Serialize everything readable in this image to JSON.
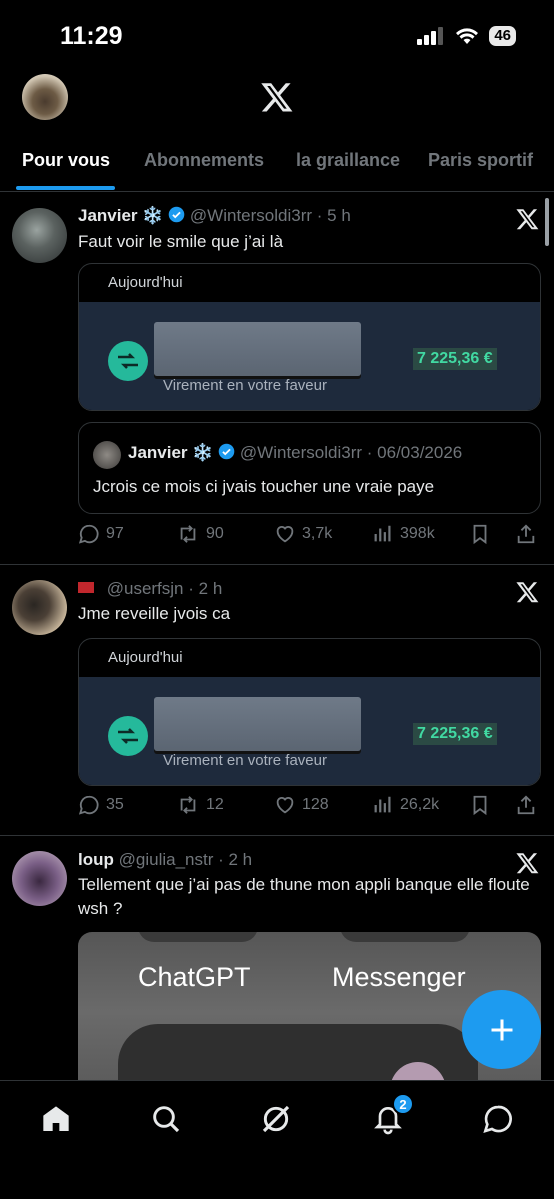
{
  "status_bar": {
    "time": "11:29",
    "battery": "46"
  },
  "header": {
    "logo_icon": "x-logo-icon"
  },
  "tabs": [
    {
      "label": "Pour vous",
      "active": true
    },
    {
      "label": "Abonnements",
      "active": false
    },
    {
      "label": "la graillance",
      "active": false
    },
    {
      "label": "Paris sportif",
      "active": false
    }
  ],
  "posts": [
    {
      "name": "Janvier",
      "name_emoji": "❄️",
      "verified": true,
      "handle": "@Wintersoldi3rr",
      "time": "· 5 h",
      "text": "Faut voir le smile que j’ai là",
      "card": {
        "date_label": "Aujourd'hui",
        "subtitle": "Virement en votre faveur",
        "amount": "7 225,36 €"
      },
      "quote": {
        "name": "Janvier",
        "name_emoji": "❄️",
        "verified": true,
        "handle": "@Wintersoldi3rr",
        "date": "· 06/03/2026",
        "text": "Jcrois ce mois ci jvais toucher une vraie paye"
      },
      "stats": {
        "replies": "97",
        "reposts": "90",
        "likes": "3,7k",
        "views": "398k"
      }
    },
    {
      "handle": "@userfsjn",
      "time": "· 2 h",
      "text": "Jme reveille jvois ca",
      "card": {
        "date_label": "Aujourd'hui",
        "subtitle": "Virement en votre faveur",
        "amount": "7 225,36 €"
      },
      "stats": {
        "replies": "35",
        "reposts": "12",
        "likes": "128",
        "views": "26,2k"
      }
    },
    {
      "name": "loup",
      "handle": "@giulia_nstr",
      "time": "· 2 h",
      "text": "Tellement que j’ai pas de thune mon appli banque elle floute wsh ?",
      "media": {
        "label_left": "ChatGPT",
        "label_right": "Messenger"
      }
    }
  ],
  "bottom_nav": {
    "notifications_badge": "2"
  },
  "colors": {
    "accent": "#1d9bf0",
    "background": "#000000",
    "money_green": "#41d9a2"
  }
}
